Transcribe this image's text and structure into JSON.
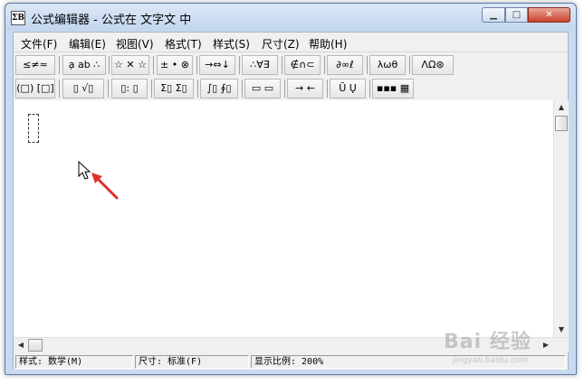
{
  "window": {
    "title": "公式编辑器 - 公式在 文字文 中",
    "app_icon": "ΣΒ",
    "min_icon": "minimize-icon",
    "max_icon": "maximize-icon",
    "close_label": "✕"
  },
  "menu": {
    "items": [
      "文件(F)",
      "编辑(E)",
      "视图(V)",
      "格式(T)",
      "样式(S)",
      "尺寸(Z)",
      "帮助(H)"
    ]
  },
  "toolbar": {
    "row1": [
      "≤≠≈",
      "ạ ab ∴",
      "☆ ✕ ☆",
      "± • ⊗",
      "→⇔↓",
      "∴∀∃",
      "∉∩⊂",
      "∂∞ℓ",
      "λωθ",
      "ΛΩ⊛"
    ],
    "row2": [
      "(□) [□]",
      "▯ √▯",
      "▯: ▯",
      "Σ▯ Σ▯",
      "∫▯ ∮▯",
      "▭ ▭",
      "→ ←",
      "Ū Ų",
      "▪▪▪ ▦"
    ]
  },
  "status": {
    "style": "样式: 数学(M)",
    "size": "尺寸: 标准(F)",
    "zoom": "显示比例: 200%"
  },
  "watermark": {
    "text": "Bai 经验",
    "sub": "jingyan.baidu.com"
  },
  "colors": {
    "title_gradient_top": "#dbe7f6",
    "close_button": "#c8412c",
    "annotation_arrow": "#e0302a"
  }
}
